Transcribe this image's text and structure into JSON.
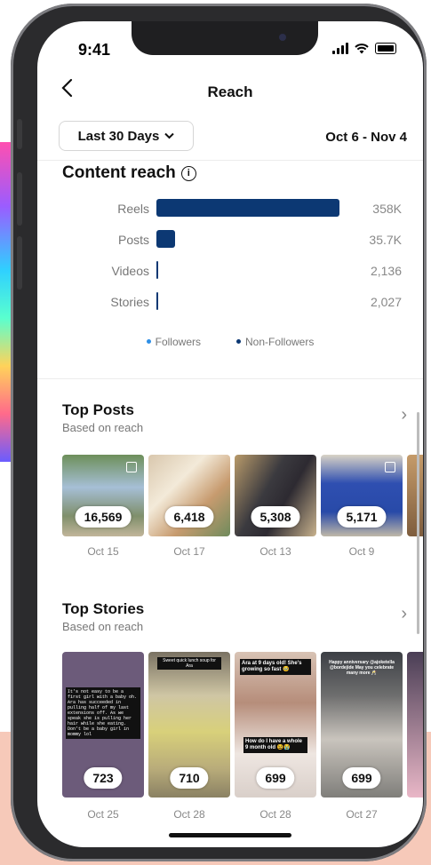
{
  "status_bar": {
    "time": "9:41"
  },
  "header": {
    "title": "Reach"
  },
  "filter": {
    "label": "Last 30 Days",
    "range": "Oct 6 - Nov 4"
  },
  "content_reach": {
    "title": "Content reach",
    "rows": [
      {
        "label": "Reels",
        "value": "358K",
        "fraction": 1.0
      },
      {
        "label": "Posts",
        "value": "35.7K",
        "fraction": 0.1
      },
      {
        "label": "Videos",
        "value": "2,136",
        "fraction": 0.006
      },
      {
        "label": "Stories",
        "value": "2,027",
        "fraction": 0.006
      }
    ],
    "legend": [
      {
        "label": "Followers",
        "color": "#2e8fe6"
      },
      {
        "label": "Non-Followers",
        "color": "#0c3873"
      }
    ]
  },
  "top_posts": {
    "title": "Top Posts",
    "subtitle": "Based on reach",
    "items": [
      {
        "count": "16,569",
        "date": "Oct 15"
      },
      {
        "count": "6,418",
        "date": "Oct 17"
      },
      {
        "count": "5,308",
        "date": "Oct 13"
      },
      {
        "count": "5,171",
        "date": "Oct 9"
      }
    ]
  },
  "top_stories": {
    "title": "Top Stories",
    "subtitle": "Based on reach",
    "items": [
      {
        "count": "723",
        "date": "Oct 25",
        "caption": "It's not easy to be a first girl with a baby oh. Ara has succeeded in pulling half of my last extensions off. As we speak she is pulling her hair while she eating. Don't be a baby girl in mommy lol"
      },
      {
        "count": "710",
        "date": "Oct 28",
        "caption": "Sweet quick lunch soup for Ara"
      },
      {
        "count": "699",
        "date": "Oct 28",
        "caption": "Ara at 9 days old! She's growing so fast 🥹",
        "caption2": "How do I have a whole 9 month old 😫😭"
      },
      {
        "count": "699",
        "date": "Oct 27",
        "caption": "Happy anniversary @ajoketella @bordejide May you celebrate many more 🥂"
      }
    ]
  }
}
